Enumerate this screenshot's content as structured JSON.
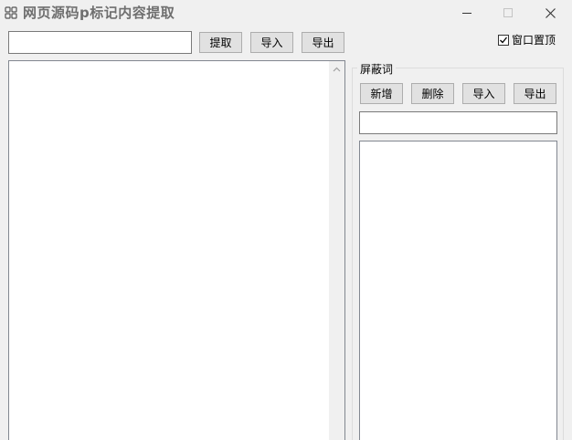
{
  "window": {
    "title": "网页源码p标记内容提取"
  },
  "toolbar": {
    "url_value": "",
    "extract_label": "提取",
    "import_label": "导入",
    "export_label": "导出"
  },
  "topmost_checkbox": {
    "label": "窗口置顶",
    "checked": true
  },
  "content": {
    "text": ""
  },
  "filter_group": {
    "title": "屏蔽词",
    "add_label": "新增",
    "delete_label": "删除",
    "import_label": "导入",
    "export_label": "导出",
    "input_value": "",
    "items": []
  }
}
